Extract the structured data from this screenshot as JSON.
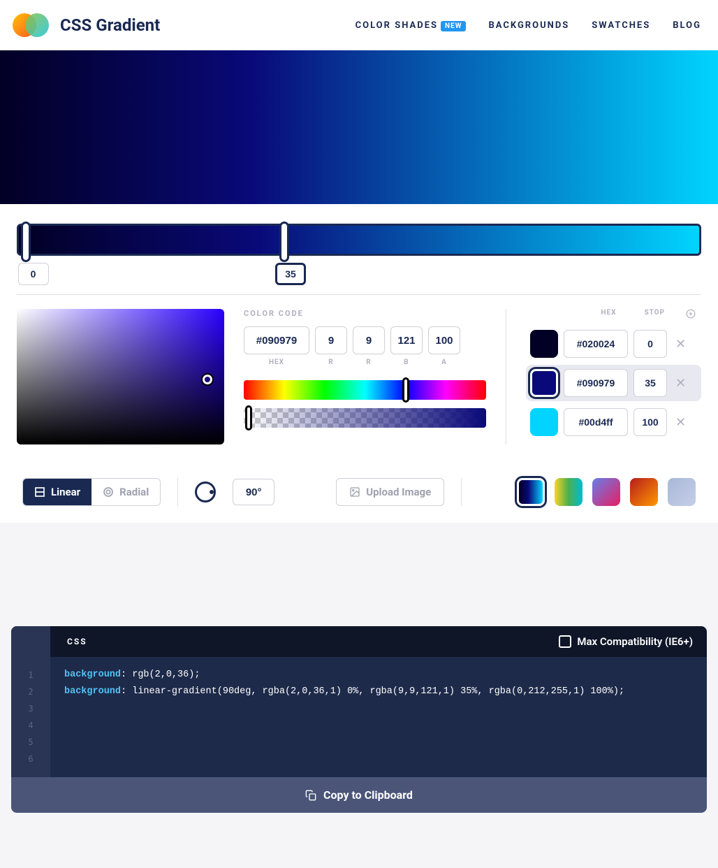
{
  "header": {
    "title": "CSS Gradient",
    "nav": {
      "shades": "COLOR SHADES",
      "new_badge": "NEW",
      "backgrounds": "BACKGROUNDS",
      "swatches": "SWATCHES",
      "blog": "BLOG"
    }
  },
  "gradient": {
    "stops": [
      {
        "hex": "#020024",
        "pos": 0,
        "color": "#020024"
      },
      {
        "hex": "#090979",
        "pos": 35,
        "color": "#090979"
      },
      {
        "hex": "#00d4ff",
        "pos": 100,
        "color": "#00d4ff"
      }
    ],
    "selected_index": 1
  },
  "color_code": {
    "label": "COLOR CODE",
    "hex": "#090979",
    "r": "9",
    "g": "9",
    "b": "121",
    "a": "100",
    "sublabels": {
      "hex": "HEX",
      "r": "R",
      "g": "R",
      "b": "B",
      "a": "A"
    }
  },
  "stops_panel": {
    "hex_label": "HEX",
    "stop_label": "STOP"
  },
  "type": {
    "linear": "Linear",
    "radial": "Radial",
    "angle": "90°"
  },
  "upload": {
    "label": "Upload Image"
  },
  "presets": [
    "linear-gradient(90deg,#020024,#090979 40%,#00d4ff)",
    "linear-gradient(90deg,#f9d423,#4caf50,#00bcd4)",
    "linear-gradient(135deg,#667eea,#e91e63)",
    "linear-gradient(135deg,#b71c1c,#ff9800)",
    "linear-gradient(135deg,#a8b8d8,#c5cee8)"
  ],
  "code": {
    "tab": "CSS",
    "compat": "Max Compatibility (IE6+)",
    "line1_key": "background",
    "line1_val": ": rgb(2,0,36);",
    "line2_key": "background",
    "line2_val": ": linear-gradient(90deg, rgba(2,0,36,1) 0%, rgba(9,9,121,1) 35%, rgba(0,212,255,1) 100%);",
    "copy": "Copy to Clipboard"
  }
}
